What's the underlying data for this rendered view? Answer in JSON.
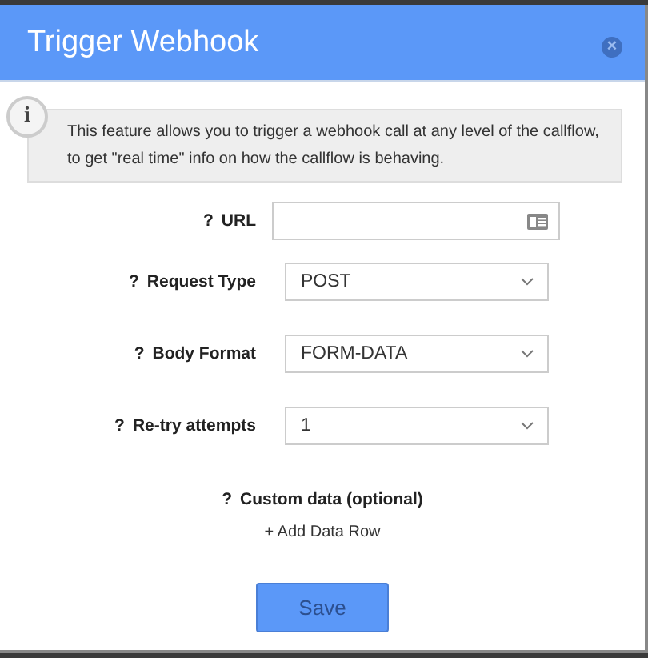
{
  "dialog": {
    "title": "Trigger Webhook",
    "close": "×"
  },
  "info": {
    "icon": "i",
    "text": "This feature allows you to trigger a webhook call at any level of the callflow, to get \"real time\" info on how the callflow is behaving."
  },
  "fields": [
    {
      "kind": "text",
      "help": "?",
      "label": "URL"
    },
    {
      "kind": "select",
      "help": "?",
      "label": "Request Type",
      "value": "POST"
    },
    {
      "kind": "select",
      "help": "?",
      "label": "Body Format",
      "value": "FORM-DATA"
    },
    {
      "kind": "select",
      "help": "?",
      "label": "Re-try attempts",
      "value": "1"
    }
  ],
  "custom_data": {
    "help": "?",
    "label": "Custom data (optional)",
    "add_link": "+ Add Data Row"
  },
  "save_button": "Save"
}
